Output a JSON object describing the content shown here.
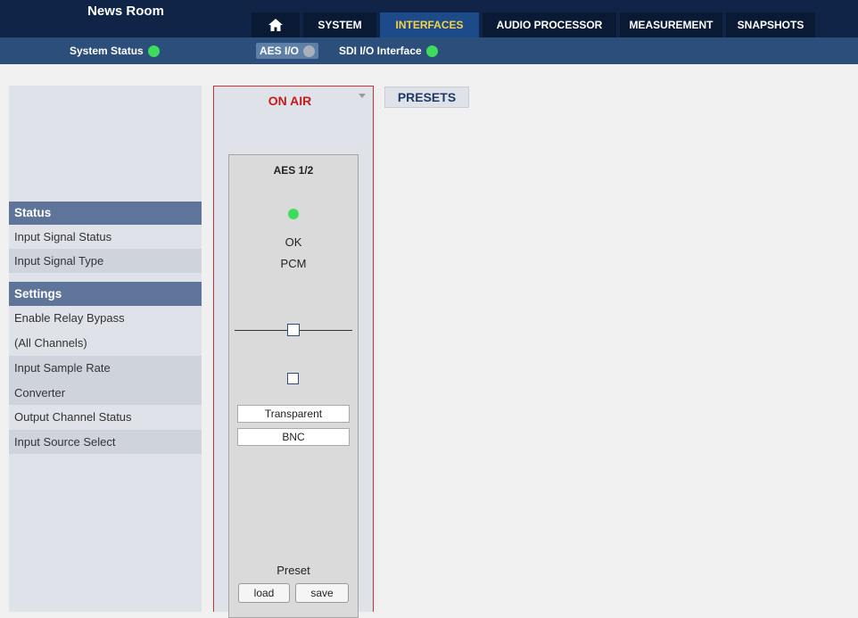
{
  "app": {
    "title": "News Room"
  },
  "nav": {
    "home_icon": "home-icon",
    "tabs": [
      {
        "label": "SYSTEM",
        "active": false
      },
      {
        "label": "INTERFACES",
        "active": true
      },
      {
        "label": "AUDIO PROCESSOR",
        "active": false
      },
      {
        "label": "MEASUREMENT",
        "active": false
      },
      {
        "label": "SNAPSHOTS",
        "active": false
      }
    ]
  },
  "status_bar": {
    "system_status_label": "System Status",
    "system_status_color": "#3ddc5c",
    "aes_io_label": "AES I/O",
    "aes_io_color": "#a8b0bb",
    "sdi_io_label": "SDI I/O Interface",
    "sdi_io_color": "#3ddc5c"
  },
  "left_panel": {
    "status_header": "Status",
    "status_rows": [
      "Input Signal Status",
      "Input Signal Type"
    ],
    "settings_header": "Settings",
    "settings_rows": [
      "Enable Relay Bypass",
      "(All Channels)",
      "Input Sample Rate",
      "Converter",
      "Output Channel Status",
      "Input Source Select"
    ]
  },
  "on_air": {
    "label": "ON AIR",
    "accent_color": "#c91a1a"
  },
  "presets_button": "PRESETS",
  "channel": {
    "title": "AES 1/2",
    "signal_status_color": "#3ddc5c",
    "signal_status_text": "OK",
    "signal_type": "PCM",
    "relay_bypass_enabled": false,
    "src_enabled": false,
    "output_channel_status": "Transparent",
    "input_source": "BNC",
    "preset_label": "Preset",
    "load_label": "load",
    "save_label": "save"
  }
}
